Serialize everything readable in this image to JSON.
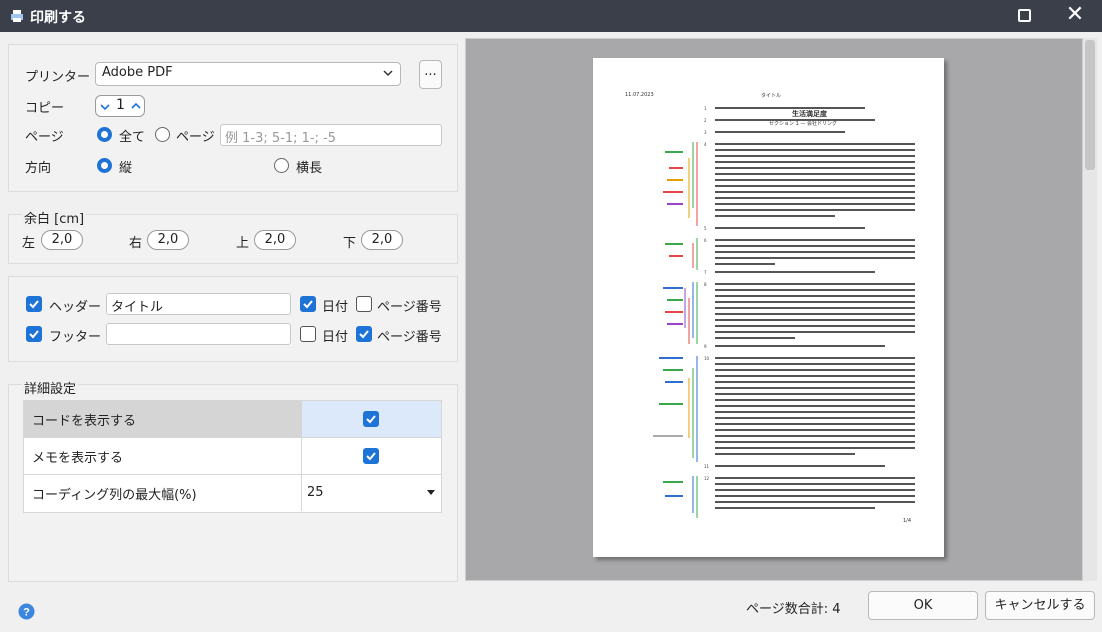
{
  "window": {
    "title": "印刷する"
  },
  "printer": {
    "label": "プリンター",
    "value": "Adobe PDF",
    "browse_label": "..."
  },
  "copies": {
    "label": "コピー",
    "value": "1"
  },
  "pages": {
    "label": "ページ",
    "all_label": "全て",
    "range_label": "ページ",
    "range_placeholder": "例 1-3; 5-1; 1-; -5",
    "selected": "all"
  },
  "orientation": {
    "label": "方向",
    "portrait_label": "縦",
    "landscape_label": "横長",
    "selected": "portrait"
  },
  "margins": {
    "title": "余白 [cm]",
    "left_label": "左",
    "left": "2,0",
    "right_label": "右",
    "right": "2,0",
    "top_label": "上",
    "top": "2,0",
    "bottom_label": "下",
    "bottom": "2,0"
  },
  "header": {
    "enabled": true,
    "label": "ヘッダー",
    "text": "タイトル",
    "date_label": "日付",
    "date_checked": true,
    "page_number_label": "ページ番号",
    "page_number_checked": false
  },
  "footer": {
    "enabled": true,
    "label": "フッター",
    "text": "",
    "date_label": "日付",
    "date_checked": false,
    "page_number_label": "ページ番号",
    "page_number_checked": true
  },
  "details": {
    "title": "詳細設定",
    "rows": [
      {
        "label": "コードを表示する",
        "checked": true
      },
      {
        "label": "メモを表示する",
        "checked": true
      },
      {
        "label": "コーディング列の最大幅(%)",
        "value": "25"
      }
    ]
  },
  "preview": {
    "header_date": "11.07.2023",
    "header_title": "タイトル",
    "doc_title": "生活満足度",
    "section": "セクション 1 — 会社ドリング",
    "page_number": "1/4"
  },
  "footer_bar": {
    "page_total": "ページ数合計: 4",
    "ok_label": "OK",
    "cancel_label": "キャンセルする"
  },
  "colors": {
    "accent": "#1e73d6",
    "titlebar": "#3a3f4a",
    "selected_row": "#d5d5d5",
    "selected_cell": "#dce9fb"
  },
  "icons": [
    "print-icon",
    "maximize-icon",
    "close-icon",
    "chevron-down-icon",
    "chevron-up-icon",
    "check-icon",
    "help-icon",
    "dropdown-arrow-icon"
  ]
}
